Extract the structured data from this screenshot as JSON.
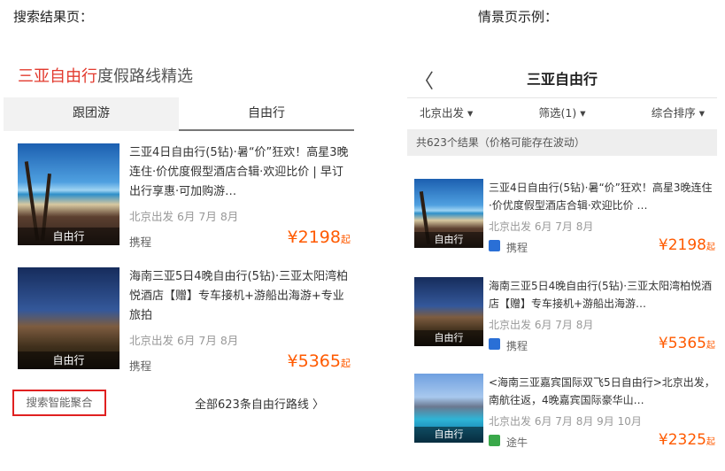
{
  "captions": {
    "left": "搜索结果页：",
    "right": "情景页示例："
  },
  "left": {
    "title_red": "三亚自由行",
    "title_rest": "度假路线精选",
    "tabs": [
      "跟团游",
      "自由行"
    ],
    "items": [
      {
        "title": "三亚4日自由行(5钻)·暑“价”狂欢！高星3晚连住·价优度假型酒店合辑·欢迎比价 | 早订出行享惠·可加购游…",
        "departure": "北京出发 6月 7月 8月",
        "badge": "自由行",
        "vendor": "携程",
        "price": "¥2198",
        "price_suffix": "起"
      },
      {
        "title": "海南三亚5日4晚自由行(5钻)·三亚太阳湾柏悦酒店【赠】专车接机+游船出海游+专业旅拍",
        "departure": "北京出发 6月 7月 8月",
        "badge": "自由行",
        "vendor": "携程",
        "price": "¥5365",
        "price_suffix": "起"
      }
    ],
    "smart_aggregate": "搜索智能聚合",
    "all_routes": "全部623条自由行路线",
    "all_routes_arrow": "〉"
  },
  "right": {
    "back": "〈",
    "title": "三亚自由行",
    "filters": [
      "北京出发 ▾",
      "筛选(1) ▾",
      "综合排序 ▾"
    ],
    "count": "共623个结果（价格可能存在波动）",
    "items": [
      {
        "title": "三亚4日自由行(5钻)·暑“价”狂欢！高星3晚连住·价优度假型酒店合辑·欢迎比价 …",
        "departure": "北京出发 6月 7月 8月",
        "badge": "自由行",
        "vendor": "携程",
        "vendor_color": "#2a6fd6",
        "price": "¥2198",
        "price_suffix": "起"
      },
      {
        "title": "海南三亚5日4晚自由行(5钻)·三亚太阳湾柏悦酒店【赠】专车接机+游船出海游…",
        "departure": "北京出发 6月 7月 8月",
        "badge": "自由行",
        "vendor": "携程",
        "vendor_color": "#2a6fd6",
        "price": "¥5365",
        "price_suffix": "起"
      },
      {
        "title": "<海南三亚嘉宾国际双飞5日自由行>北京出发，南航往返，4晚嘉宾国际豪华山…",
        "departure": "北京出发 6月 7月 8月 9月 10月",
        "badge": "自由行",
        "vendor": "途牛",
        "vendor_color": "#3aa84a",
        "price": "¥2325",
        "price_suffix": "起"
      }
    ]
  }
}
